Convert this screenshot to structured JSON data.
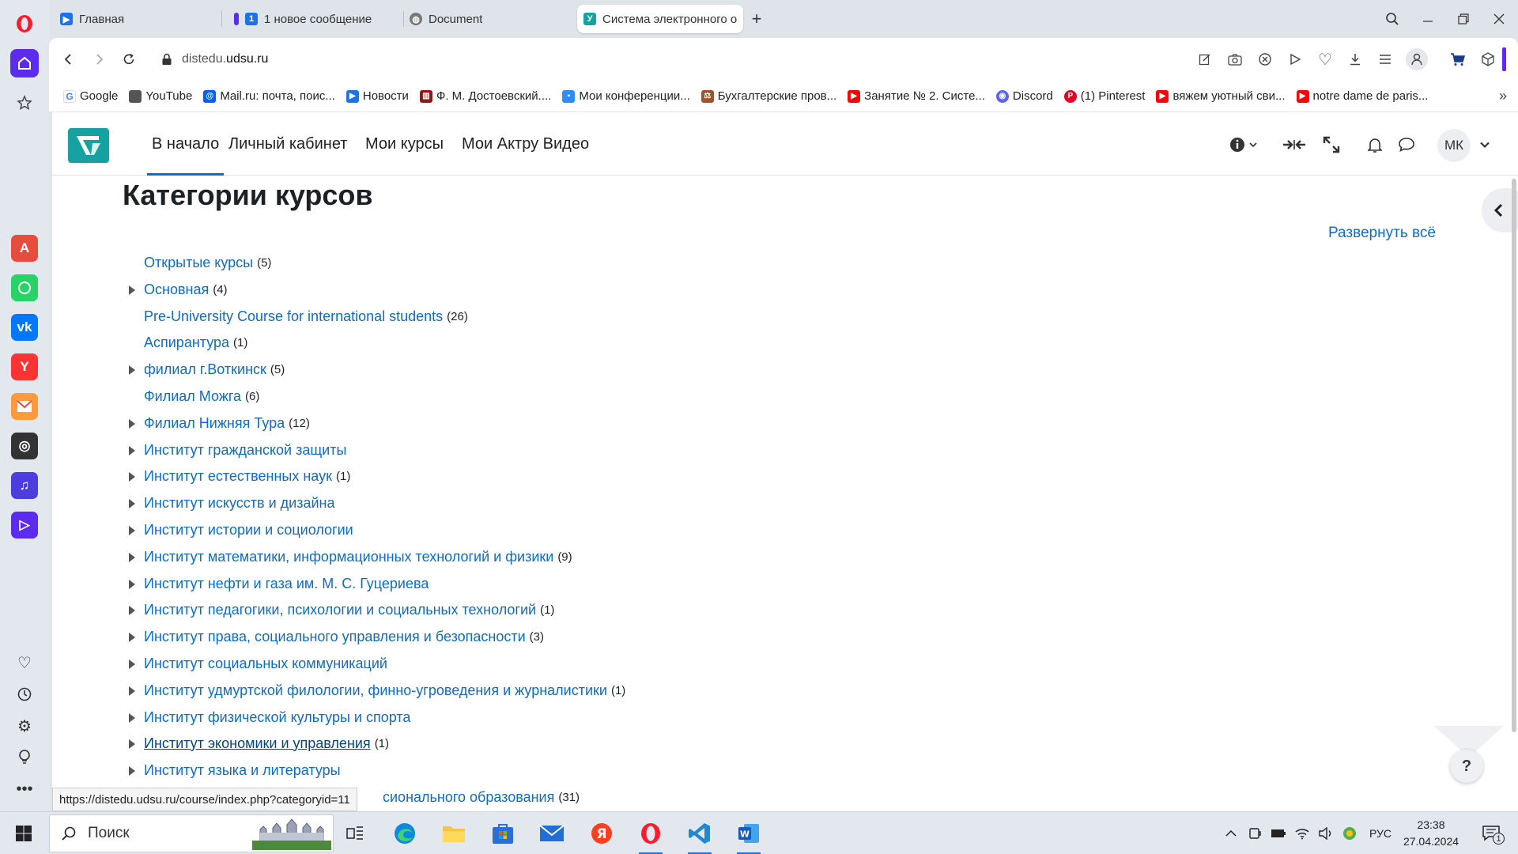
{
  "tabs": [
    {
      "title": "Главная"
    },
    {
      "title": "1 новое сообщение"
    },
    {
      "title": "Document"
    },
    {
      "title": "Система электронного о"
    }
  ],
  "address": {
    "url_prefix": "distedu.",
    "url_domain": "udsu.ru"
  },
  "bookmarks": [
    {
      "label": "Google",
      "icon": "google-icon",
      "color": "#4285f4"
    },
    {
      "label": "YouTube",
      "icon": "document-icon",
      "color": "#555555"
    },
    {
      "label": "Mail.ru: почта, поис...",
      "icon": "mailru-icon",
      "color": "#005ff9"
    },
    {
      "label": "Новости",
      "icon": "play-icon",
      "color": "#1a73e8"
    },
    {
      "label": "Ф. М. Достоевский....",
      "icon": "book-icon",
      "color": "#8b1a1a"
    },
    {
      "label": "Мои конференции...",
      "icon": "zoom-icon",
      "color": "#2d8cff"
    },
    {
      "label": "Бухгалтерские пров...",
      "icon": "scales-icon",
      "color": "#a0522d"
    },
    {
      "label": "Занятие № 2. Систе...",
      "icon": "youtube-icon",
      "color": "#ff0000"
    },
    {
      "label": "Discord",
      "icon": "discord-icon",
      "color": "#5865f2"
    },
    {
      "label": "(1) Pinterest",
      "icon": "pinterest-icon",
      "color": "#e60023"
    },
    {
      "label": "вяжем уютный сви...",
      "icon": "youtube-icon",
      "color": "#ff0000"
    },
    {
      "label": "notre dame de paris...",
      "icon": "youtube-icon",
      "color": "#ff0000"
    }
  ],
  "site_nav": {
    "items": [
      {
        "label": "В начало"
      },
      {
        "label": "Личный кабинет"
      },
      {
        "label": "Мои курсы"
      },
      {
        "label": "Мои Актру Видео"
      }
    ],
    "avatar": "МК"
  },
  "page": {
    "title": "Категории курсов",
    "expand_all": "Развернуть всё"
  },
  "categories": [
    {
      "name": "Открытые курсы",
      "count": "(5)",
      "expandable": false
    },
    {
      "name": "Основная",
      "count": "(4)",
      "expandable": true
    },
    {
      "name": "Pre-University Course for international students",
      "count": "(26)",
      "expandable": false
    },
    {
      "name": "Аспирантура",
      "count": "(1)",
      "expandable": false
    },
    {
      "name": "филиал г.Воткинск",
      "count": "(5)",
      "expandable": true
    },
    {
      "name": "Филиал Можга",
      "count": "(6)",
      "expandable": false
    },
    {
      "name": "Филиал Нижняя Тура",
      "count": "(12)",
      "expandable": true
    },
    {
      "name": "Институт гражданской защиты",
      "count": "",
      "expandable": true
    },
    {
      "name": "Институт естественных наук",
      "count": "(1)",
      "expandable": true
    },
    {
      "name": "Институт искусств и дизайна",
      "count": "",
      "expandable": true
    },
    {
      "name": "Институт истории и социологии",
      "count": "",
      "expandable": true
    },
    {
      "name": "Институт математики, информационных технологий и физики",
      "count": "(9)",
      "expandable": true
    },
    {
      "name": "Институт нефти и газа им. М. С. Гуцериева",
      "count": "",
      "expandable": true
    },
    {
      "name": "Институт педагогики, психологии и социальных технологий",
      "count": "(1)",
      "expandable": true
    },
    {
      "name": "Институт права, социального управления и безопасности",
      "count": "(3)",
      "expandable": true
    },
    {
      "name": "Институт социальных коммуникаций",
      "count": "",
      "expandable": true
    },
    {
      "name": "Институт удмуртской филологии, финно-угроведения и журналистики",
      "count": "(1)",
      "expandable": true
    },
    {
      "name": "Институт физической культуры и спорта",
      "count": "",
      "expandable": true
    },
    {
      "name": "Институт экономики и управления",
      "count": "(1)",
      "expandable": true,
      "hovered": true
    },
    {
      "name": "Институт языка и литературы",
      "count": "",
      "expandable": true
    },
    {
      "name": "сионального образования",
      "count": "(31)",
      "expandable": false
    }
  ],
  "status_url": "https://distedu.udsu.ru/course/index.php?categoryid=11",
  "help_label": "?",
  "taskbar": {
    "search_placeholder": "Поиск",
    "language": "РУС",
    "time": "23:38",
    "date": "27.04.2024",
    "notifications": "1"
  },
  "colors": {
    "link": "#0f6cbf",
    "brand": "#17a2a2",
    "opera_red": "#ff1b2d"
  }
}
